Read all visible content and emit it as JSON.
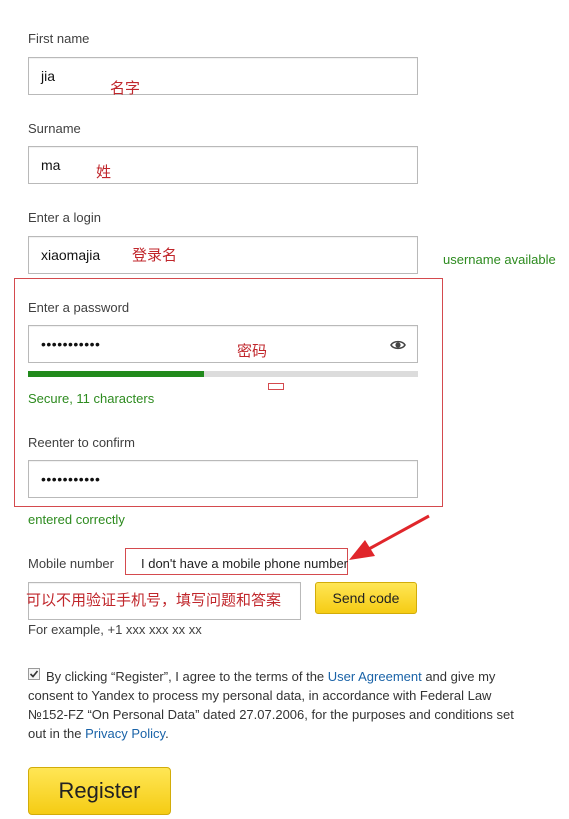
{
  "form": {
    "first_name": {
      "label": "First name",
      "value": "jia",
      "annotation": "名字"
    },
    "surname": {
      "label": "Surname",
      "value": "ma",
      "annotation": "姓"
    },
    "login": {
      "label": "Enter a login",
      "value": "xiaomajia",
      "annotation": "登录名",
      "status": "username available"
    },
    "password": {
      "label": "Enter a password",
      "value": "•••••••••••",
      "annotation": "密码",
      "strength_fraction": 0.45,
      "strength_text": "Secure, 11 characters",
      "eye_icon": "eye-icon"
    },
    "confirm": {
      "label": "Reenter to confirm",
      "value": "•••••••••••",
      "status": "entered correctly"
    },
    "phone": {
      "label": "Mobile number",
      "no_phone_link": "I don't have a mobile phone number",
      "annotation": "可以不用验证手机号，填写问题和答案",
      "send_code": "Send code",
      "example": "For example, +1 xxx xxx xx xx"
    },
    "agreement": {
      "checked": true,
      "text_1": "By clicking “Register”, I agree to the terms of the ",
      "link_1": "User Agreement",
      "text_2": " and give my consent to Yandex to process my personal data, in accordance with Federal Law №152-FZ “On Personal Data” dated 27.07.2006, for the purposes and conditions set out in the ",
      "link_2": "Privacy Policy",
      "text_3": "."
    },
    "register_button": "Register"
  },
  "colors": {
    "annotation_red": "#c0262b",
    "status_green": "#2d8b1f",
    "strength_bar": "#218a1c",
    "button_yellow": "#f5cc14",
    "link_blue": "#1a63a8"
  }
}
